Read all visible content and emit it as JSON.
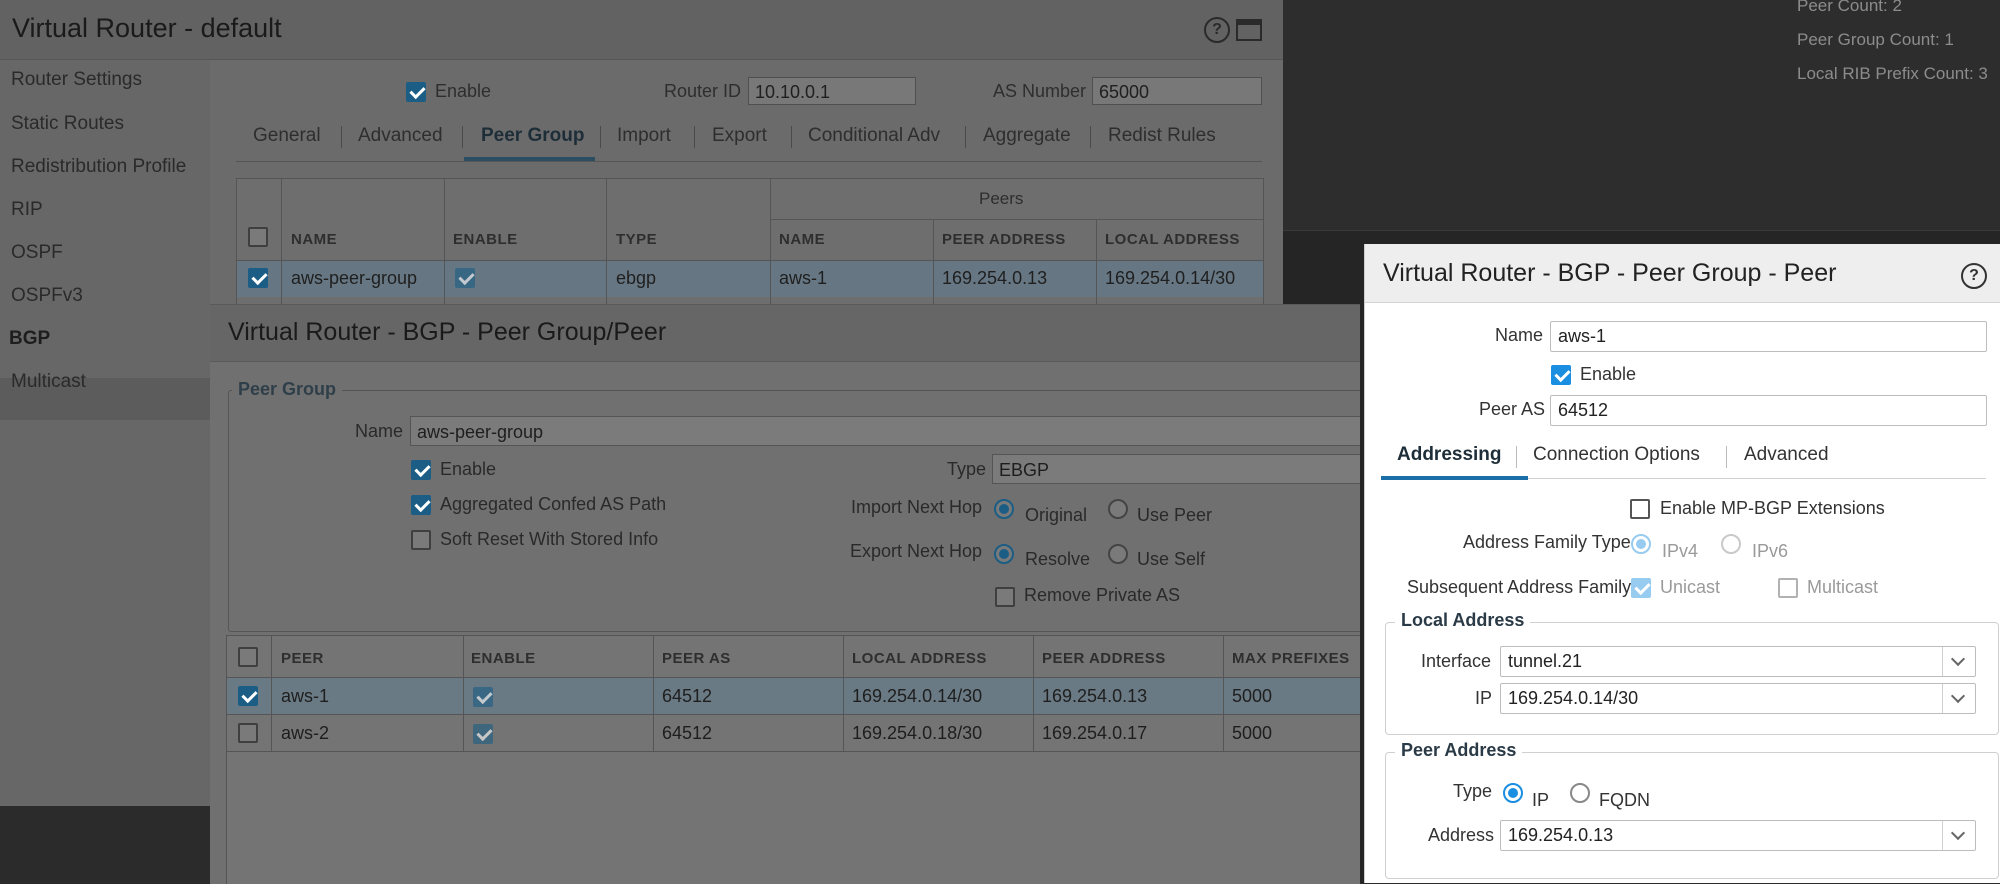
{
  "stats": {
    "peer_count": "Peer Count: 2",
    "peer_group_count": "Peer Group Count: 1",
    "local_rib_prefix_count": "Local RIB Prefix Count: 3"
  },
  "router_window": {
    "title": "Virtual Router - default",
    "sidebar": [
      "Router Settings",
      "Static Routes",
      "Redistribution Profile",
      "RIP",
      "OSPF",
      "OSPFv3",
      "BGP",
      "Multicast"
    ],
    "enable_label": "Enable",
    "router_id_label": "Router ID",
    "router_id_value": "10.10.0.1",
    "as_number_label": "AS Number",
    "as_number_value": "65000",
    "tabs": [
      "General",
      "Advanced",
      "Peer Group",
      "Import",
      "Export",
      "Conditional Adv",
      "Aggregate",
      "Redist Rules"
    ],
    "active_tab": "Peer Group",
    "grid": {
      "group_header": "Peers",
      "columns": [
        "NAME",
        "ENABLE",
        "TYPE",
        "NAME",
        "PEER ADDRESS",
        "LOCAL ADDRESS"
      ],
      "rows": [
        {
          "name": "aws-peer-group",
          "type": "ebgp",
          "peer_name": "aws-1",
          "peer_address": "169.254.0.13",
          "local_address": "169.254.0.14/30"
        }
      ]
    }
  },
  "peer_group_window": {
    "title": "Virtual Router - BGP - Peer Group/Peer",
    "legend": "Peer Group",
    "name_label": "Name",
    "name_value": "aws-peer-group",
    "enable_label": "Enable",
    "aggregated_label": "Aggregated Confed AS Path",
    "soft_reset_label": "Soft Reset With Stored Info",
    "type_label": "Type",
    "type_value": "EBGP",
    "import_next_hop_label": "Import Next Hop",
    "import_opt1": "Original",
    "import_opt2": "Use Peer",
    "export_next_hop_label": "Export Next Hop",
    "export_opt1": "Resolve",
    "export_opt2": "Use Self",
    "remove_private_as_label": "Remove Private AS",
    "grid": {
      "columns": [
        "PEER",
        "ENABLE",
        "PEER AS",
        "LOCAL ADDRESS",
        "PEER ADDRESS",
        "MAX PREFIXES"
      ],
      "rows": [
        {
          "peer": "aws-1",
          "peer_as": "64512",
          "local_address": "169.254.0.14/30",
          "peer_address": "169.254.0.13",
          "max_prefixes": "5000"
        },
        {
          "peer": "aws-2",
          "peer_as": "64512",
          "local_address": "169.254.0.18/30",
          "peer_address": "169.254.0.17",
          "max_prefixes": "5000"
        }
      ]
    }
  },
  "peer_window": {
    "title": "Virtual Router - BGP - Peer Group - Peer",
    "name_label": "Name",
    "name_value": "aws-1",
    "enable_label": "Enable",
    "peer_as_label": "Peer AS",
    "peer_as_value": "64512",
    "tabs": [
      "Addressing",
      "Connection Options",
      "Advanced"
    ],
    "active_tab": "Addressing",
    "mp_bgp_label": "Enable MP-BGP Extensions",
    "address_family_label": "Address Family Type",
    "af_ipv4": "IPv4",
    "af_ipv6": "IPv6",
    "subsequent_label": "Subsequent Address Family",
    "unicast_label": "Unicast",
    "multicast_label": "Multicast",
    "local_address_legend": "Local Address",
    "interface_label": "Interface",
    "interface_value": "tunnel.21",
    "ip_label": "IP",
    "ip_value": "169.254.0.14/30",
    "peer_address_legend": "Peer Address",
    "type_label": "Type",
    "type_ip": "IP",
    "type_fqdn": "FQDN",
    "address_label": "Address",
    "address_value": "169.254.0.13"
  }
}
